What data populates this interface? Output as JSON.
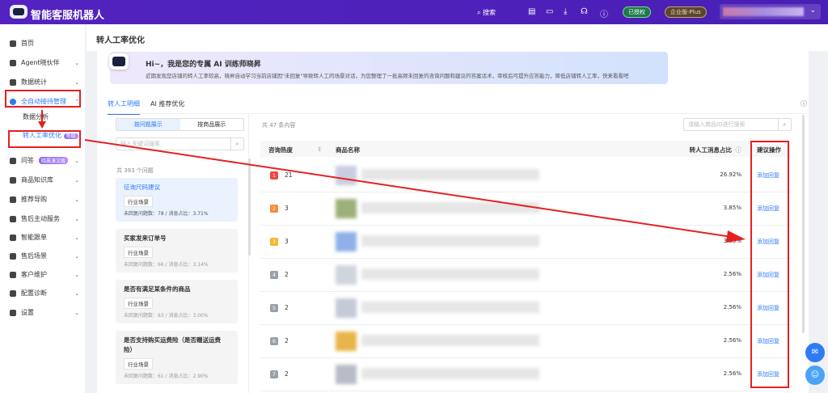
{
  "header": {
    "brand": "智能客服机器人",
    "search": "搜索",
    "authorized": "已授权",
    "edition": "企业版-Plus"
  },
  "sidebar": {
    "items": [
      "首页",
      "Agent晓伙伴",
      "数据统计",
      "全自动接待管理",
      "问答",
      "商品知识库",
      "推荐导购",
      "售后主动服务",
      "智能跟单",
      "售后场景",
      "客户维护",
      "配置诊断",
      "设置"
    ],
    "qa_badge": "晓晨演文版",
    "sub": [
      "数据分析",
      "转人工率优化"
    ],
    "sub_badge": "等级"
  },
  "page": {
    "title": "转人工率优化"
  },
  "banner": {
    "title": "Hi~，我是您的专属 AI 训练师晓昇",
    "text": "近期发现您店铺的转人工率较高，晓昇自动学习当前店铺因\"未回复\"导致转人工的场景对话，为您整理了一批高频未回复的咨询问题和建议的答案话术，审核后可提升应答能力，降低店铺转人工率，快来看看吧"
  },
  "tabs": [
    "转人工明细",
    "AI 推荐优化"
  ],
  "left": {
    "segments": [
      "按问题展示",
      "按商品展示"
    ],
    "search_placeholder": "输入关键词搜索",
    "count": "共 393 个问题",
    "questions": [
      {
        "title": "征询尺码建议",
        "tag": "行业场景",
        "meta": "未回复问题数：78 / 消息占比：3.71%"
      },
      {
        "title": "买家发来订单号",
        "tag": "行业场景",
        "meta": "未回复问题数：66 / 消息占比：3.14%"
      },
      {
        "title": "是否有满足某条件的商品",
        "tag": "行业场景",
        "meta": "未回复问题数：63 / 消息占比：3.00%"
      },
      {
        "title": "是否支持购买运费险（是否赠送运费险）",
        "tag": "行业场景",
        "meta": "未回复问题数：61 / 消息占比：2.90%"
      }
    ]
  },
  "right": {
    "count": "共 47 条内容",
    "search_placeholder": "请输入商品ID进行搜索",
    "columns": [
      "咨询热度",
      "商品名称",
      "转人工消息占比",
      "建议操作"
    ],
    "rows": [
      {
        "rank": "1",
        "hot": "21",
        "pct": "26.92%",
        "action": "添加回复"
      },
      {
        "rank": "2",
        "hot": "3",
        "pct": "3.85%",
        "action": "添加回复"
      },
      {
        "rank": "3",
        "hot": "3",
        "pct": "3.85%",
        "action": "添加回复"
      },
      {
        "rank": "4",
        "hot": "2",
        "pct": "2.56%",
        "action": "添加回复"
      },
      {
        "rank": "5",
        "hot": "2",
        "pct": "2.56%",
        "action": "添加回复"
      },
      {
        "rank": "6",
        "hot": "2",
        "pct": "2.56%",
        "action": "添加回复"
      },
      {
        "rank": "7",
        "hot": "2",
        "pct": "2.56%",
        "action": "添加回复"
      }
    ]
  },
  "colors": {
    "header": "#4b1fb8",
    "accent": "#2f7bf5",
    "rank1": "#f0493e",
    "rank2": "#f78a3a",
    "rank3": "#f5b731",
    "rankN": "#9aa0a8",
    "annotation": "#e52020"
  }
}
